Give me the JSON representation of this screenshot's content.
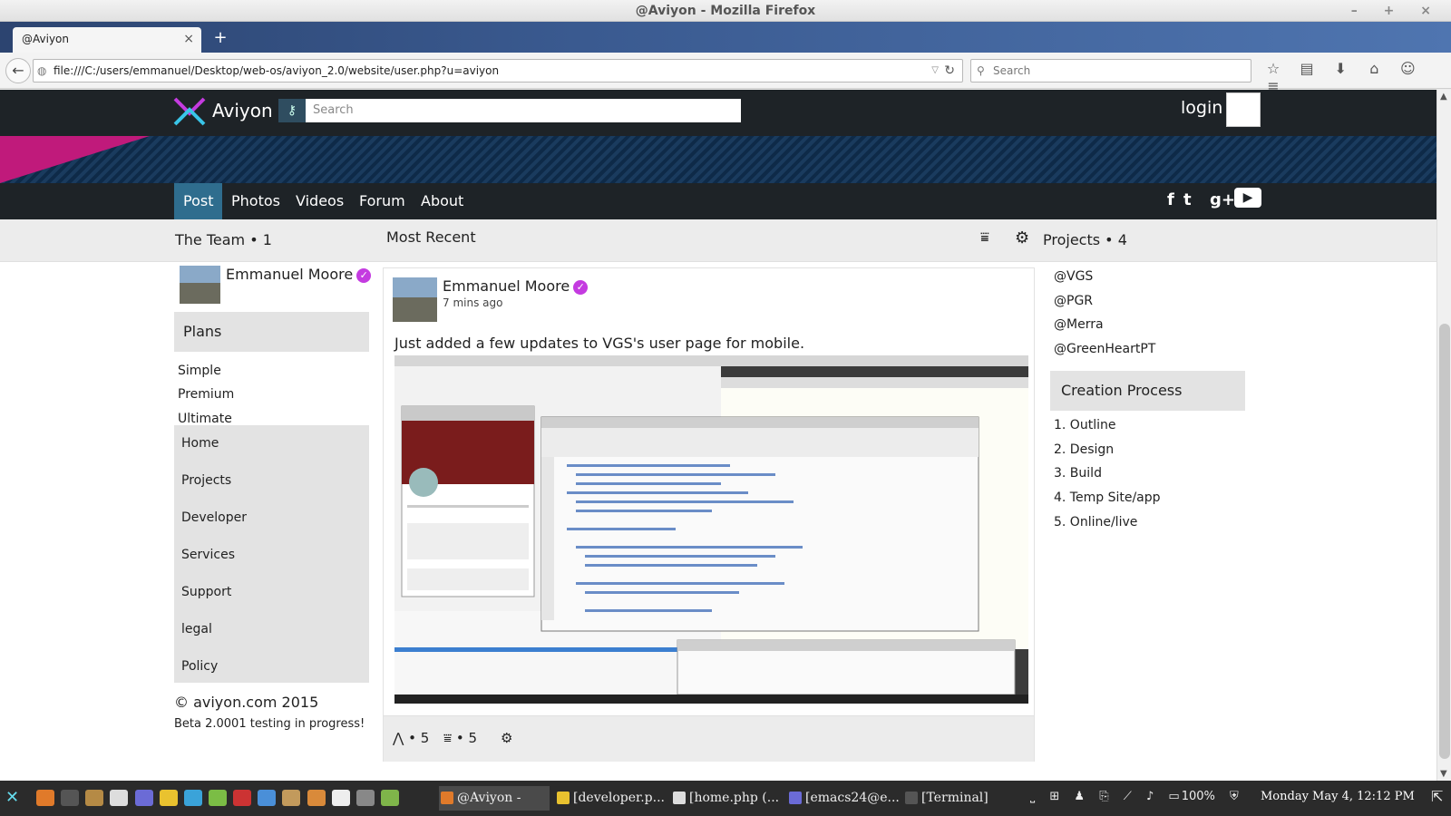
{
  "window": {
    "title": "@Aviyon - Mozilla Firefox",
    "controls": "– + ×"
  },
  "browser": {
    "tab_title": "@Aviyon",
    "tab_close": "×",
    "new_tab": "+",
    "url": "file:///C:/users/emmanuel/Desktop/web-os/aviyon_2.0/website/user.php?u=aviyon",
    "search_placeholder": "Search",
    "toolbar_icons": [
      "star-icon",
      "bookmarks-icon",
      "download-icon",
      "home-icon",
      "chat-icon",
      "menu-icon"
    ]
  },
  "site": {
    "brand": "Aviyon",
    "search_placeholder": "Search",
    "login": "login",
    "nav": [
      "Post",
      "Photos",
      "Videos",
      "Forum",
      "About"
    ],
    "social": [
      "f",
      "t",
      "g+",
      "▶"
    ],
    "colors": {
      "accent": "#2f6d8e",
      "brand_pink": "#c01a7b",
      "header_bg": "#1e2327",
      "verified": "#c43be0"
    }
  },
  "subbar": {
    "team": "The Team • 1",
    "most_recent": "Most Recent",
    "projects": "Projects • 4"
  },
  "left": {
    "member_name": "Emmanuel Moore",
    "plans_title": "Plans",
    "plans": [
      "Simple",
      "Premium",
      "Ultimate"
    ],
    "menu": [
      "Home",
      "Projects",
      "Developer",
      "Services",
      "Support",
      "legal",
      "Policy"
    ],
    "copyright": "© aviyon.com 2015",
    "beta": "Beta 2.0001 testing in progress!"
  },
  "post": {
    "author": "Emmanuel Moore",
    "time": "7 mins ago",
    "text": "Just added a few updates to VGS's user page for mobile.",
    "likes": "• 5",
    "comments": "• 5"
  },
  "right": {
    "projects": [
      "@VGS",
      "@PGR",
      "@Merra",
      "@GreenHeartPT"
    ],
    "creation_title": "Creation Process",
    "steps": [
      "1.  Outline",
      "2.  Design",
      "3.  Build",
      "4.  Temp Site/app",
      "5.  Online/live"
    ]
  },
  "taskbar": {
    "windows": [
      "@Aviyon - M...",
      "[developer.p...",
      "[home.php (...",
      "[emacs24@e...",
      "[Terminal]"
    ],
    "battery": "100%",
    "clock": "Monday May  4, 12:12 PM"
  }
}
